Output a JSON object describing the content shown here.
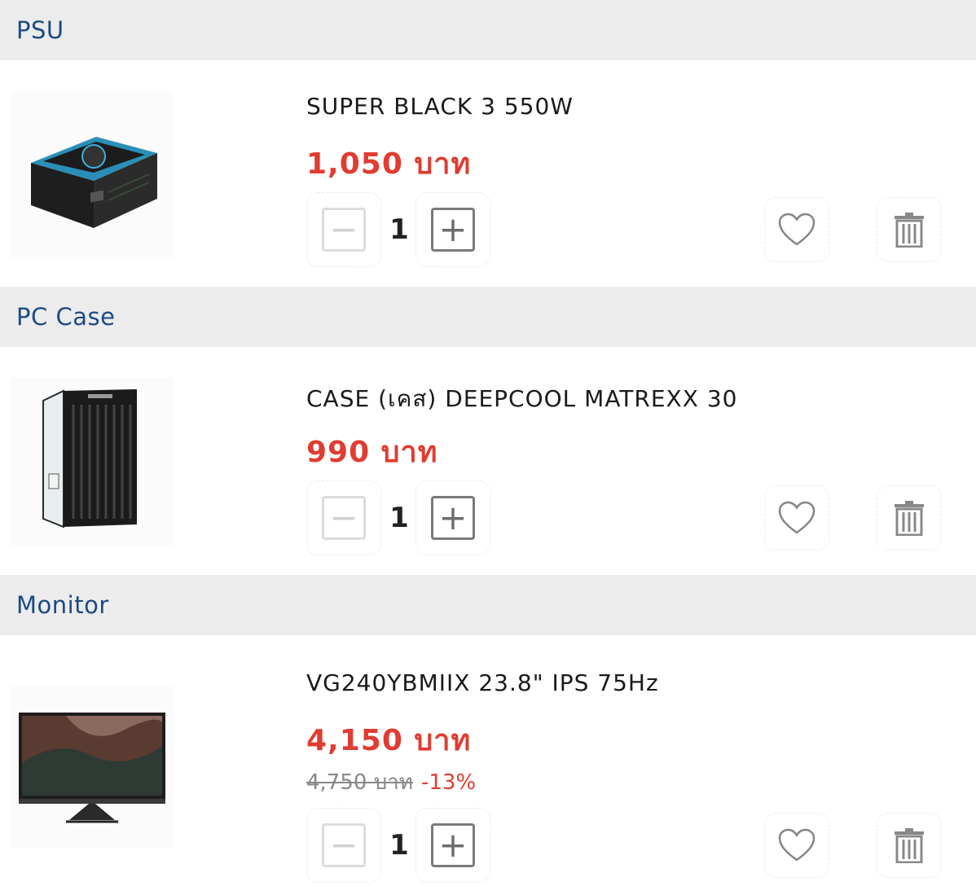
{
  "categories": [
    {
      "title": "PSU",
      "item": {
        "name": "SUPER BLACK 3 550W",
        "price": "1,050 บาท",
        "quantity": "1",
        "image": "psu-image"
      }
    },
    {
      "title": "PC Case",
      "item": {
        "name": "CASE (เคส) DEEPCOOL MATREXX 30",
        "price": "990 บาท",
        "quantity": "1",
        "image": "pc-case-image"
      }
    },
    {
      "title": "Monitor",
      "item": {
        "name": "VG240YBMIIX 23.8\" IPS 75Hz",
        "price": "4,150 บาท",
        "old_price": "4,750 บาท",
        "discount": "-13%",
        "quantity": "1",
        "image": "monitor-image"
      }
    }
  ],
  "controls": {
    "minus_symbol": "−",
    "plus_symbol": "+",
    "wishlist_icon": "heart-icon",
    "delete_icon": "trash-icon"
  },
  "colors": {
    "category_text": "#1c4a85",
    "header_bg": "#ececec",
    "price": "#e03c31",
    "old_price": "#888888"
  }
}
